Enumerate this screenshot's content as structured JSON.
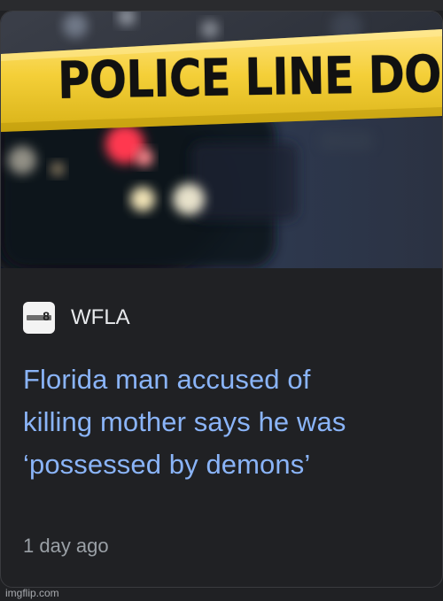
{
  "hero": {
    "tape_text": "POLICE LINE DO N"
  },
  "source": {
    "name": "WFLA",
    "logo_text": "8"
  },
  "headline": {
    "line1": "Florida man accused of",
    "line2": "killing mother says he was",
    "line3": "‘possessed by demons’"
  },
  "meta": {
    "timestamp": "1 day ago"
  },
  "watermark": {
    "text": "imgflip.com"
  },
  "colors": {
    "background": "#202124",
    "headline_link": "#8ab4f8",
    "source_text": "#e8eaed",
    "secondary_text": "#9aa0a6",
    "tape": "#f2c400"
  }
}
